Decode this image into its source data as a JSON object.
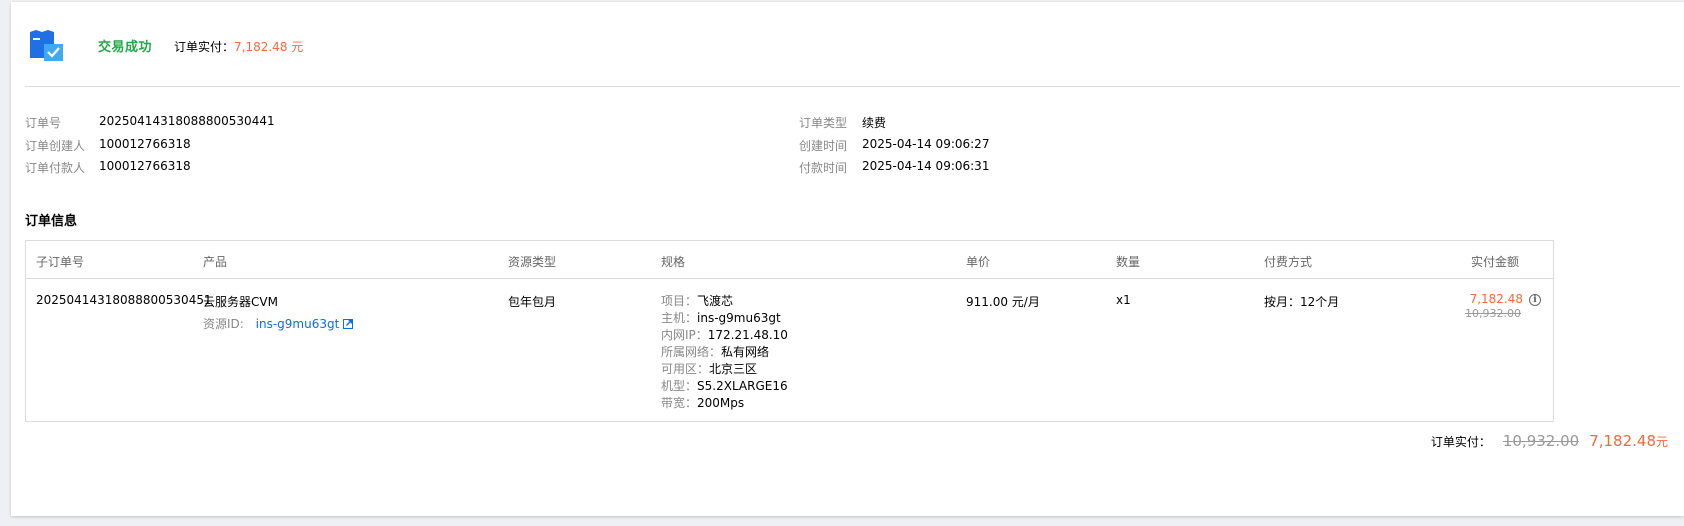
{
  "header": {
    "status": "交易成功",
    "paid_label": "订单实付：",
    "paid_amount": "7,182.48 元"
  },
  "order_info": {
    "left": [
      {
        "label": "订单号",
        "value": "20250414318088800530441"
      },
      {
        "label": "订单创建人",
        "value": "100012766318"
      },
      {
        "label": "订单付款人",
        "value": "100012766318"
      }
    ],
    "right": [
      {
        "label": "订单类型",
        "value": "续费"
      },
      {
        "label": "创建时间",
        "value": "2025-04-14 09:06:27"
      },
      {
        "label": "付款时间",
        "value": "2025-04-14 09:06:31"
      }
    ]
  },
  "section_title": "订单信息",
  "table": {
    "headers": [
      "子订单号",
      "产品",
      "资源类型",
      "规格",
      "单价",
      "数量",
      "付费方式",
      "实付金额"
    ],
    "row": {
      "sub_order_no": "20250414318088800530451",
      "product": "云服务器CVM",
      "resource_id_label": "资源ID:",
      "resource_id": "ins-g9mu63gt",
      "resource_type": "包年包月",
      "specs": [
        {
          "label": "项目：",
          "value": "飞渡芯"
        },
        {
          "label": "主机：",
          "value": "ins-g9mu63gt"
        },
        {
          "label": "内网IP：",
          "value": "172.21.48.10"
        },
        {
          "label": "所属网络：",
          "value": "私有网络"
        },
        {
          "label": "可用区：",
          "value": "北京三区"
        },
        {
          "label": "机型：",
          "value": "S5.2XLARGE16"
        },
        {
          "label": "带宽：",
          "value": "200Mps"
        }
      ],
      "unit_price": "911.00 元/月",
      "quantity": "x1",
      "billing": "按月：12个月",
      "paid": "7,182.48",
      "original": "10,932.00"
    }
  },
  "total": {
    "label": "订单实付：",
    "original": "10,932.00",
    "paid": "7,182.48",
    "unit": "元"
  },
  "colors": {
    "success": "#21a849",
    "price": "#f2693a",
    "link": "#0a6ee6",
    "icon_blue": "#1f6fe5"
  },
  "icons": {
    "status": "order-success-icon",
    "external": "external-link-icon",
    "info": "info-circle-icon"
  }
}
